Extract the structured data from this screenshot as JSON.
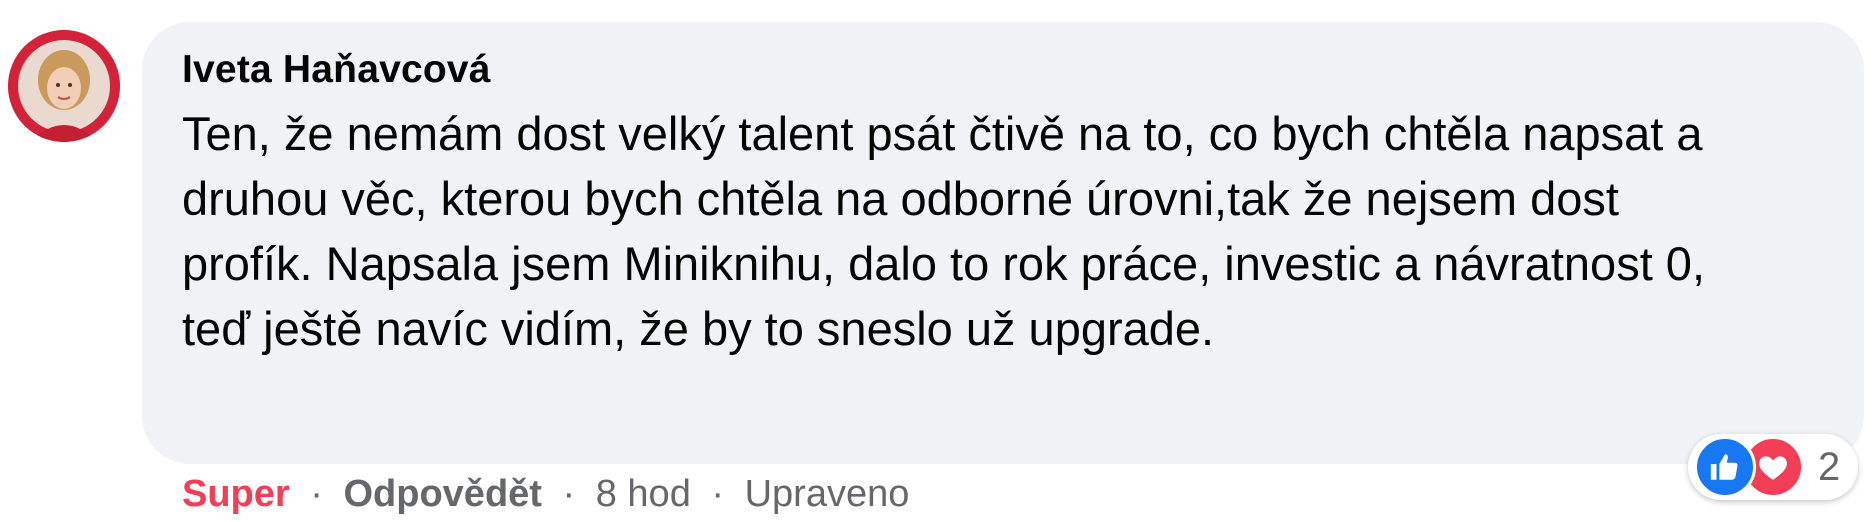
{
  "comment": {
    "author": "Iveta Haňavcová",
    "text": "Ten, že nemám dost velký talent psát čtivě na to, co bych chtěla napsat a druhou věc, kterou bych chtěla na odborné úrovni,tak že nejsem dost profík. Napsala jsem Miniknihu, dalo to rok práce, investic a návratnost 0, teď ještě navíc vidím, že by to sneslo už upgrade."
  },
  "actions": {
    "react_label": "Super",
    "reply_label": "Odpovědět",
    "time": "8 hod",
    "edited": "Upraveno",
    "separator": "·"
  },
  "reactions": {
    "icons": [
      "like-icon",
      "love-icon"
    ],
    "count": "2"
  },
  "colors": {
    "bubble_bg": "#f0f2f5",
    "super_red": "#f33e58",
    "like_blue": "#1877f2",
    "secondary_text": "#65676b"
  }
}
